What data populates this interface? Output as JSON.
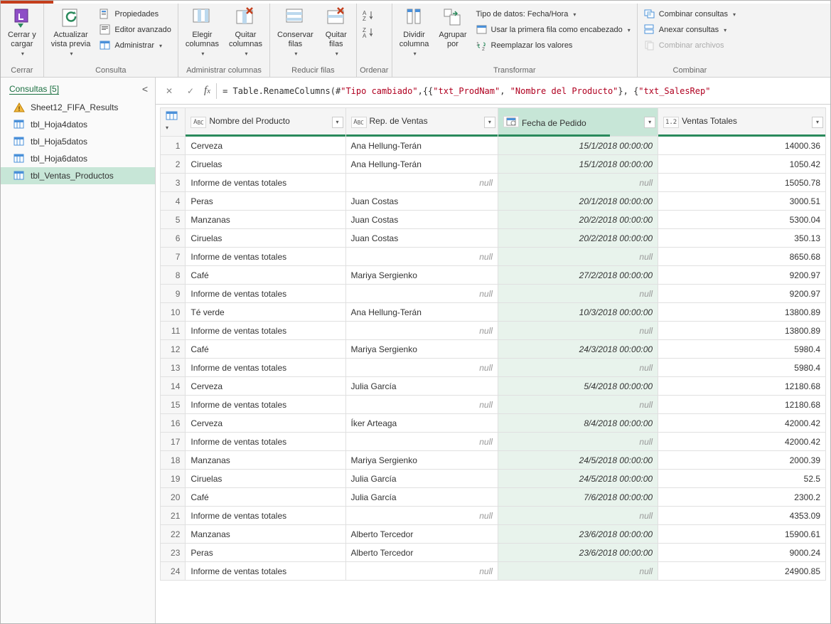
{
  "ribbon": {
    "groups": {
      "cerrar": {
        "label": "Cerrar",
        "close_load": "Cerrar y\ncargar"
      },
      "consulta": {
        "label": "Consulta",
        "refresh": "Actualizar\nvista previa",
        "props": "Propiedades",
        "adv_editor": "Editor avanzado",
        "manage": "Administrar"
      },
      "admin_cols": {
        "label": "Administrar columnas",
        "choose": "Elegir\ncolumnas",
        "remove": "Quitar\ncolumnas"
      },
      "reduce_rows": {
        "label": "Reducir filas",
        "keep": "Conservar\nfilas",
        "remove": "Quitar\nfilas"
      },
      "ordenar": {
        "label": "Ordenar"
      },
      "transform": {
        "label": "Transformar",
        "split": "Dividir\ncolumna",
        "group": "Agrupar\npor",
        "datatype": "Tipo de datos: Fecha/Hora",
        "first_row": "Usar la primera fila como encabezado",
        "replace": "Reemplazar los valores"
      },
      "combine": {
        "label": "Combinar",
        "merge": "Combinar consultas",
        "append": "Anexar consultas",
        "combine_files": "Combinar archivos"
      }
    }
  },
  "sidebar": {
    "title": "Consultas [5]",
    "items": [
      {
        "label": "Sheet12_FIFA_Results",
        "icon": "warning"
      },
      {
        "label": "tbl_Hoja4datos",
        "icon": "table"
      },
      {
        "label": "tbl_Hoja5datos",
        "icon": "table"
      },
      {
        "label": "tbl_Hoja6datos",
        "icon": "table"
      },
      {
        "label": "tbl_Ventas_Productos",
        "icon": "table",
        "selected": true
      }
    ]
  },
  "formula": {
    "prefix": "= Table.RenameColumns(#",
    "s1": "\"Tipo cambiado\"",
    "mid1": ",{{",
    "s2": "\"txt_ProdNam\"",
    "mid2": ", ",
    "s3": "\"Nombre del Producto\"",
    "mid3": "}, {",
    "s4": "\"txt_SalesRep\""
  },
  "columns": [
    {
      "type": "ABC",
      "label": "Nombre del Producto"
    },
    {
      "type": "ABC",
      "label": "Rep. de Ventas"
    },
    {
      "type": "cal",
      "label": "Fecha de Pedido",
      "selected": true
    },
    {
      "type": "1.2",
      "label": "Ventas Totales"
    }
  ],
  "rows": [
    {
      "n": 1,
      "p": "Cerveza",
      "r": "Ana Hellung-Terán",
      "d": "15/1/2018 00:00:00",
      "v": "14000.36"
    },
    {
      "n": 2,
      "p": "Ciruelas",
      "r": "Ana Hellung-Terán",
      "d": "15/1/2018 00:00:00",
      "v": "1050.42"
    },
    {
      "n": 3,
      "p": "Informe de ventas totales",
      "r": null,
      "d": null,
      "v": "15050.78"
    },
    {
      "n": 4,
      "p": "Peras",
      "r": "Juan Costas",
      "d": "20/1/2018 00:00:00",
      "v": "3000.51"
    },
    {
      "n": 5,
      "p": "Manzanas",
      "r": "Juan Costas",
      "d": "20/2/2018 00:00:00",
      "v": "5300.04"
    },
    {
      "n": 6,
      "p": "Ciruelas",
      "r": "Juan Costas",
      "d": "20/2/2018 00:00:00",
      "v": "350.13"
    },
    {
      "n": 7,
      "p": "Informe de ventas totales",
      "r": null,
      "d": null,
      "v": "8650.68"
    },
    {
      "n": 8,
      "p": "Café",
      "r": "Mariya Sergienko",
      "d": "27/2/2018 00:00:00",
      "v": "9200.97"
    },
    {
      "n": 9,
      "p": "Informe de ventas totales",
      "r": null,
      "d": null,
      "v": "9200.97"
    },
    {
      "n": 10,
      "p": "Té verde",
      "r": "Ana Hellung-Terán",
      "d": "10/3/2018 00:00:00",
      "v": "13800.89"
    },
    {
      "n": 11,
      "p": "Informe de ventas totales",
      "r": null,
      "d": null,
      "v": "13800.89"
    },
    {
      "n": 12,
      "p": "Café",
      "r": "Mariya Sergienko",
      "d": "24/3/2018 00:00:00",
      "v": "5980.4"
    },
    {
      "n": 13,
      "p": "Informe de ventas totales",
      "r": null,
      "d": null,
      "v": "5980.4"
    },
    {
      "n": 14,
      "p": "Cerveza",
      "r": "Julia García",
      "d": "5/4/2018 00:00:00",
      "v": "12180.68"
    },
    {
      "n": 15,
      "p": "Informe de ventas totales",
      "r": null,
      "d": null,
      "v": "12180.68"
    },
    {
      "n": 16,
      "p": "Cerveza",
      "r": "Íker Arteaga",
      "d": "8/4/2018 00:00:00",
      "v": "42000.42"
    },
    {
      "n": 17,
      "p": "Informe de ventas totales",
      "r": null,
      "d": null,
      "v": "42000.42"
    },
    {
      "n": 18,
      "p": "Manzanas",
      "r": "Mariya Sergienko",
      "d": "24/5/2018 00:00:00",
      "v": "2000.39"
    },
    {
      "n": 19,
      "p": "Ciruelas",
      "r": "Julia García",
      "d": "24/5/2018 00:00:00",
      "v": "52.5"
    },
    {
      "n": 20,
      "p": "Café",
      "r": "Julia García",
      "d": "7/6/2018 00:00:00",
      "v": "2300.2"
    },
    {
      "n": 21,
      "p": "Informe de ventas totales",
      "r": null,
      "d": null,
      "v": "4353.09"
    },
    {
      "n": 22,
      "p": "Manzanas",
      "r": "Alberto Tercedor",
      "d": "23/6/2018 00:00:00",
      "v": "15900.61"
    },
    {
      "n": 23,
      "p": "Peras",
      "r": "Alberto Tercedor",
      "d": "23/6/2018 00:00:00",
      "v": "9000.24"
    },
    {
      "n": 24,
      "p": "Informe de ventas totales",
      "r": null,
      "d": null,
      "v": "24900.85"
    }
  ]
}
